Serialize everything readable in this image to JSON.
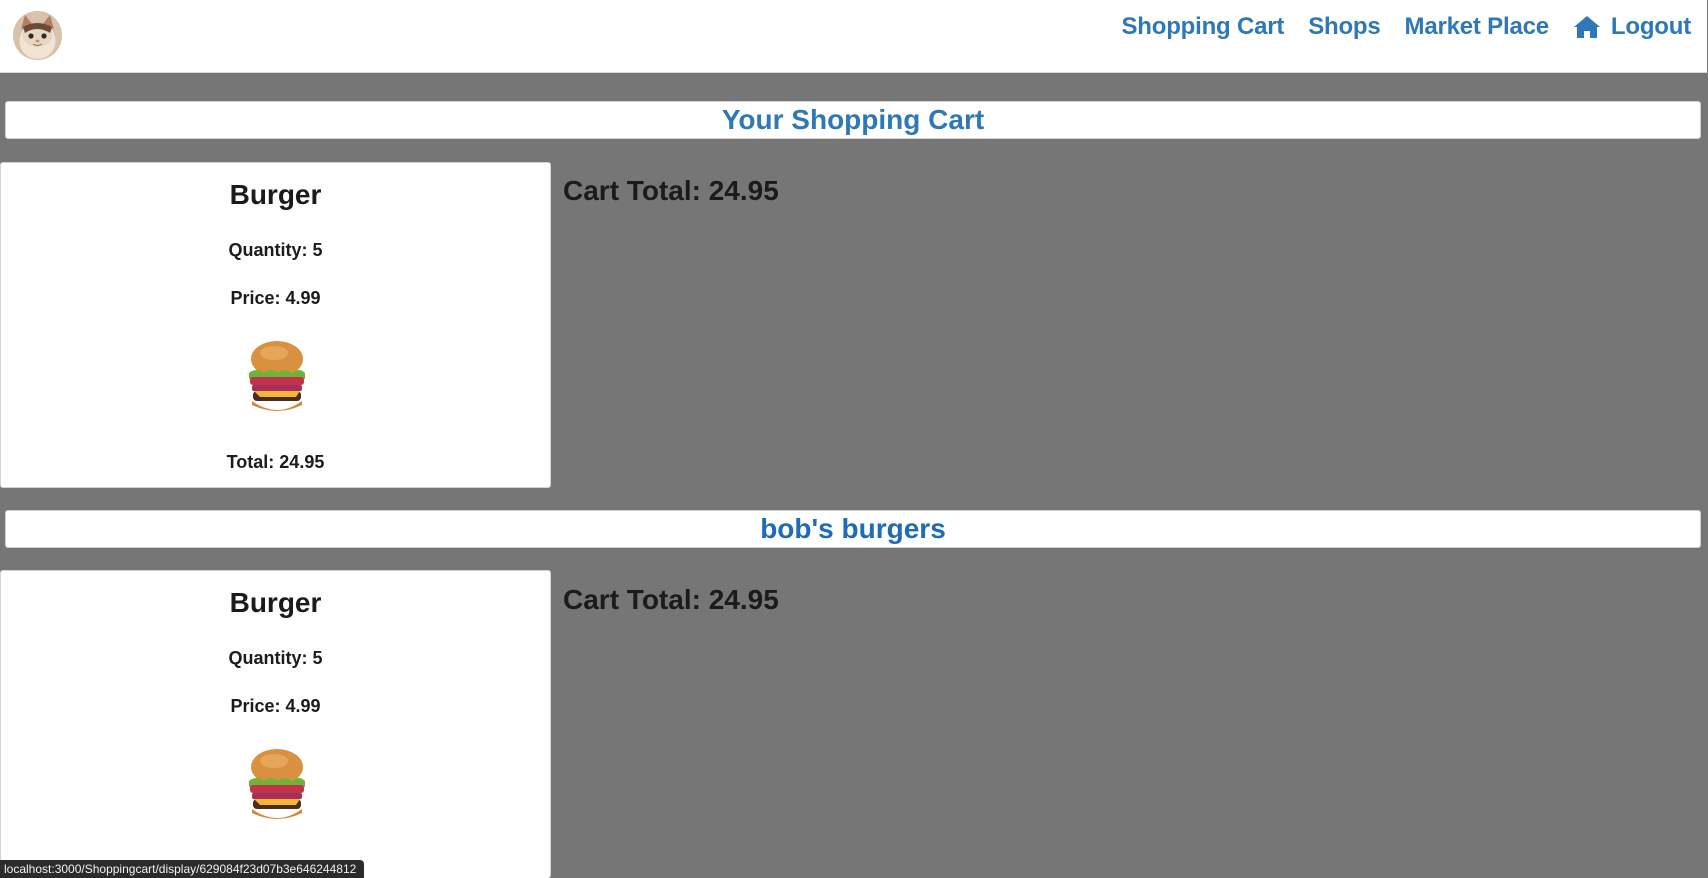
{
  "nav": {
    "links": [
      {
        "label": "Shopping Cart"
      },
      {
        "label": "Shops"
      },
      {
        "label": "Market Place"
      },
      {
        "label": "Logout",
        "icon": "home-icon"
      }
    ]
  },
  "sections": [
    {
      "header": "Your Shopping Cart",
      "item": {
        "name": "Burger",
        "quantity": "Quantity: 5",
        "price": "Price: 4.99",
        "total": "Total: 24.95"
      },
      "cart_total": "Cart Total: 24.95"
    },
    {
      "header": "bob's burgers",
      "item": {
        "name": "Burger",
        "quantity": "Quantity: 5",
        "price": "Price: 4.99"
      },
      "cart_total": "Cart Total: 24.95"
    }
  ],
  "status_bar": "localhost:3000/Shoppingcart/display/629084f23d07b3e646244812",
  "colors": {
    "accent": "#2e78b7",
    "background": "#767676"
  }
}
